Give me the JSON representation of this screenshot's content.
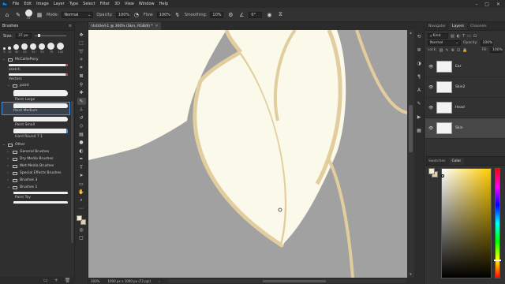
{
  "colors": {
    "foreground": "#f4efd4",
    "background": "#e7cf9c",
    "canvas_cream": "#fbf9ea",
    "canvas_gray": "#a1a1a1",
    "outline_tan": "#e2cd9e",
    "accent": "#4a90d8"
  },
  "menubar": {
    "logo": "Ps",
    "items": [
      "File",
      "Edit",
      "Image",
      "Layer",
      "Type",
      "Select",
      "Filter",
      "3D",
      "View",
      "Window",
      "Help"
    ]
  },
  "options": {
    "brush_size": "37",
    "mode_label": "Mode:",
    "mode_value": "Normal",
    "opacity_label": "Opacity:",
    "opacity_value": "100%",
    "flow_label": "Flow:",
    "flow_value": "100%",
    "smoothing_label": "Smoothing:",
    "smoothing_value": "10%",
    "angle_value": "0°"
  },
  "brushes_panel": {
    "title": "Brushes",
    "size_label": "Size:",
    "size_value": "37 px",
    "presets": [
      "5",
      "10",
      "30",
      "45",
      "50",
      "55",
      "79",
      "100"
    ],
    "groups": [
      {
        "label": "McCalliePony"
      },
      {
        "label": "sketch"
      },
      {
        "label": "Vectors"
      },
      {
        "label": "paint"
      }
    ],
    "brushes": [
      "Paint Large",
      "Paint Medium",
      "Paint Small",
      "Hard Round 7 1"
    ],
    "other_group": "Other",
    "other_folders": [
      "General Brushes",
      "Dry Media Brushes",
      "Wet Media Brushes",
      "Special Effects Brushes",
      "Brushes 3",
      "Brushes 1"
    ],
    "bottom_brush": "Paint Toy"
  },
  "document": {
    "tab_title": "Untitled-1 @ 300% (Skin, RGB/8) *",
    "zoom": "300%",
    "doc_info": "1000 px x 1000 px (72 ppi)"
  },
  "layers_panel": {
    "tabs": [
      "Navigator",
      "Layers",
      "Channels"
    ],
    "active_tab": "Layers",
    "kind_label": "Kind",
    "blend_mode": "Normal",
    "opacity_label": "Opacity:",
    "opacity_value": "100%",
    "lock_label": "Lock:",
    "fill_label": "Fill:",
    "fill_value": "100%",
    "layers": [
      {
        "name": "Ear",
        "selected": false
      },
      {
        "name": "Skin2",
        "selected": false
      },
      {
        "name": "Head",
        "selected": false
      },
      {
        "name": "Skin",
        "selected": true
      }
    ]
  },
  "color_panel": {
    "tabs": [
      "Swatches",
      "Color"
    ],
    "active_tab": "Color"
  }
}
